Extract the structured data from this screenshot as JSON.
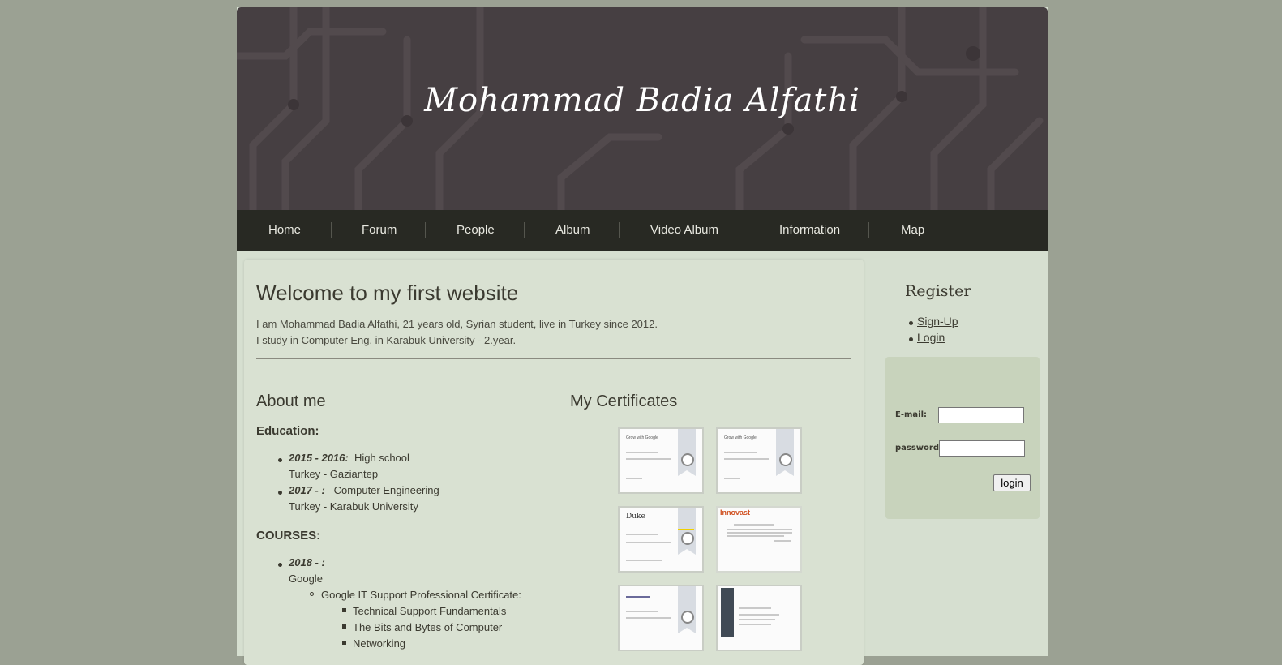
{
  "header": {
    "title": "Mohammad Badia Alfathi"
  },
  "nav": {
    "items": [
      {
        "label": "Home"
      },
      {
        "label": "Forum"
      },
      {
        "label": "People"
      },
      {
        "label": "Album"
      },
      {
        "label": "Video Album"
      },
      {
        "label": "Information"
      },
      {
        "label": "Map"
      }
    ]
  },
  "main": {
    "welcome_title": "Welcome to my first website",
    "intro_line1": "I am Mohammad Badia Alfathi, 21 years old, Syrian student, live in Turkey since 2012.",
    "intro_line2": "I study in Computer Eng. in Karabuk University - 2.year.",
    "about": {
      "title": "About me",
      "education_label": "Education:",
      "education": [
        {
          "years": "2015 - 2016:",
          "title": "High school",
          "place": "Turkey - Gaziantep"
        },
        {
          "years": "2017 - :",
          "title": "Computer Engineering",
          "place": "Turkey - Karabuk University"
        }
      ],
      "courses_label": "COURSES:",
      "course_year": "2018 - :",
      "course_provider": "Google",
      "course_program": "Google IT Support Professional Certificate:",
      "course_items": [
        "Technical Support Fundamentals",
        "The Bits and Bytes of Computer",
        "Networking"
      ]
    },
    "certificates": {
      "title": "My Certificates",
      "items": [
        {
          "brand": "Grow with Google"
        },
        {
          "brand": "Grow with Google"
        },
        {
          "brand": "Duke"
        },
        {
          "brand": "Innovast"
        },
        {
          "brand": ""
        },
        {
          "brand": ""
        }
      ]
    }
  },
  "sidebar": {
    "register_title": "Register",
    "signup_label": "Sign-Up",
    "login_link_label": "Login",
    "form": {
      "email_label": "E-mail:",
      "email_value": "",
      "password_label": "password:",
      "password_value": "",
      "login_button": "login"
    }
  },
  "colors": {
    "background": "#9ba193",
    "header": "#463f42",
    "nav": "#282923",
    "content": "#d9e1d2",
    "login_box": "#c8d3bc"
  }
}
